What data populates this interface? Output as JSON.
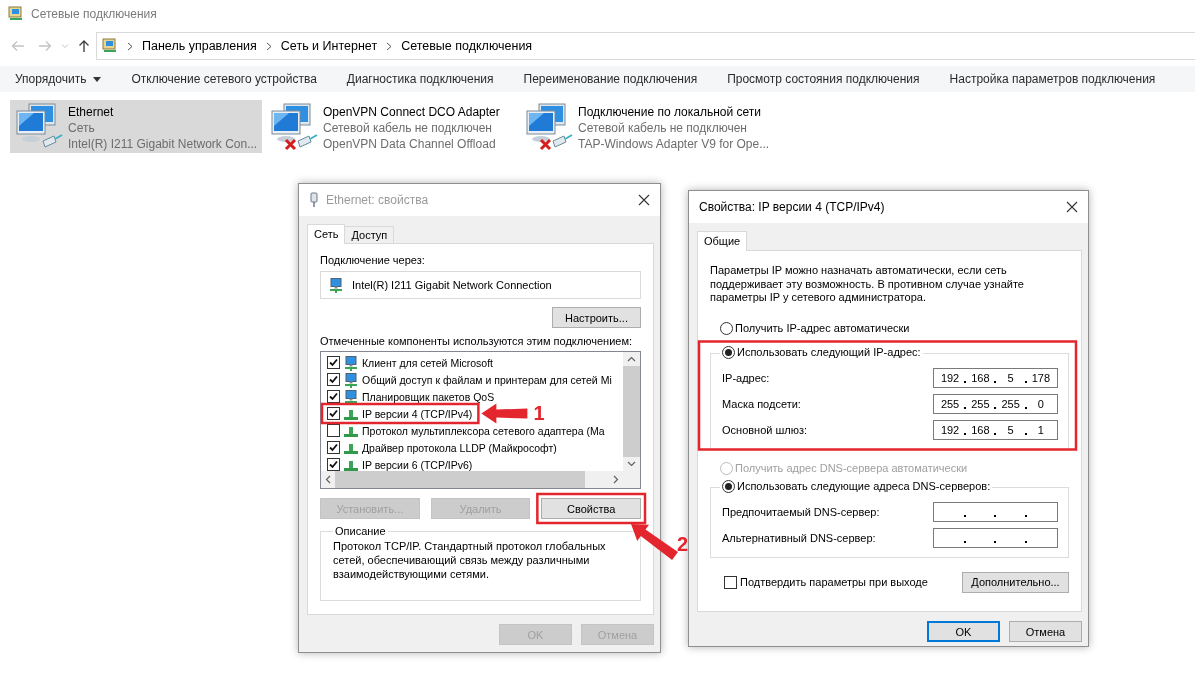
{
  "window": {
    "title": "Сетевые подключения"
  },
  "address_bar": {
    "breadcrumbs": [
      "Панель управления",
      "Сеть и Интернет",
      "Сетевые подключения"
    ]
  },
  "toolbar": [
    {
      "label": "Упорядочить",
      "kind": "menu"
    },
    {
      "label": "Отключение сетевого устройства",
      "kind": "command"
    },
    {
      "label": "Диагностика подключения",
      "kind": "command"
    },
    {
      "label": "Переименование подключения",
      "kind": "command"
    },
    {
      "label": "Просмотр состояния подключения",
      "kind": "command"
    },
    {
      "label": "Настройка параметров подключения",
      "kind": "command"
    }
  ],
  "connections": [
    {
      "name": "Ethernet",
      "status": "Сеть",
      "device": "Intel(R) I211 Gigabit Network Con...",
      "selected": true,
      "disconnected": false
    },
    {
      "name": "OpenVPN Connect DCO Adapter",
      "status": "Сетевой кабель не подключен",
      "device": "OpenVPN Data Channel Offload",
      "selected": false,
      "disconnected": true
    },
    {
      "name": "Подключение по локальной сети",
      "status": "Сетевой кабель не подключен",
      "device": "TAP-Windows Adapter V9 for Ope...",
      "selected": false,
      "disconnected": true
    }
  ],
  "ethernet_properties": {
    "title": "Ethernet: свойства",
    "tabs": [
      {
        "label": "Сеть",
        "selected": true
      },
      {
        "label": "Доступ",
        "selected": false
      }
    ],
    "connect_using_label": "Подключение через:",
    "adapter": "Intel(R) I211 Gigabit Network Connection",
    "configure_button": "Настроить...",
    "components_label": "Отмеченные компоненты используются этим подключением:",
    "components": [
      {
        "label": "Клиент для сетей Microsoft",
        "checked": true,
        "kind": "client"
      },
      {
        "label": "Общий доступ к файлам и принтерам для сетей Mi",
        "checked": true,
        "kind": "service"
      },
      {
        "label": "Планировщик пакетов QoS",
        "checked": true,
        "kind": "service"
      },
      {
        "label": "IP версии 4 (TCP/IPv4)",
        "checked": true,
        "kind": "protocol"
      },
      {
        "label": "Протокол мультиплексора сетевого адаптера (Ма",
        "checked": false,
        "kind": "protocol"
      },
      {
        "label": "Драйвер протокола LLDP (Майкрософт)",
        "checked": true,
        "kind": "protocol"
      },
      {
        "label": "IP версии 6 (TCP/IPv6)",
        "checked": true,
        "kind": "protocol"
      }
    ],
    "buttons": [
      {
        "label": "Установить...",
        "disabled": true
      },
      {
        "label": "Удалить",
        "disabled": true
      },
      {
        "label": "Свойства",
        "disabled": false
      }
    ],
    "description": {
      "title": "Описание",
      "text": "Протокол TCP/IP. Стандартный протокол глобальных сетей, обеспечивающий связь между различными взаимодействующими сетями."
    },
    "footer_buttons": [
      {
        "label": "OK",
        "disabled": true
      },
      {
        "label": "Отмена",
        "disabled": true
      }
    ]
  },
  "ipv4_properties": {
    "title": "Свойства: IP версии 4 (TCP/IPv4)",
    "tabs": [
      {
        "label": "Общие",
        "selected": true
      }
    ],
    "intro": "Параметры IP можно назначать автоматически, если сеть поддерживает эту возможность. В противном случае узнайте параметры IP у сетевого администратора.",
    "ip_mode": [
      {
        "label": "Получить IP-адрес автоматически",
        "selected": false,
        "disabled": false
      },
      {
        "label": "Использовать следующий IP-адрес:",
        "selected": true,
        "disabled": false
      }
    ],
    "ip_fields": [
      {
        "label": "IP-адрес:",
        "octets": [
          "192",
          "168",
          "5",
          "178"
        ]
      },
      {
        "label": "Маска подсети:",
        "octets": [
          "255",
          "255",
          "255",
          "0"
        ]
      },
      {
        "label": "Основной шлюз:",
        "octets": [
          "192",
          "168",
          "5",
          "1"
        ]
      }
    ],
    "dns_mode": [
      {
        "label": "Получить адрес DNS-сервера автоматически",
        "selected": false,
        "disabled": true
      },
      {
        "label": "Использовать следующие адреса DNS-серверов:",
        "selected": true,
        "disabled": false
      }
    ],
    "dns_fields": [
      {
        "label": "Предпочитаемый DNS-сервер:"
      },
      {
        "label": "Альтернативный DNS-сервер:"
      }
    ],
    "validate_on_exit": {
      "label": "Подтвердить параметры при выходе",
      "checked": false
    },
    "advanced_button": "Дополнительно...",
    "footer_buttons": [
      {
        "label": "OK",
        "default": true
      },
      {
        "label": "Отмена",
        "default": false
      }
    ]
  },
  "annotations": [
    {
      "kind": "callout",
      "label": "1"
    },
    {
      "kind": "callout",
      "label": "2"
    },
    {
      "kind": "frame"
    }
  ]
}
